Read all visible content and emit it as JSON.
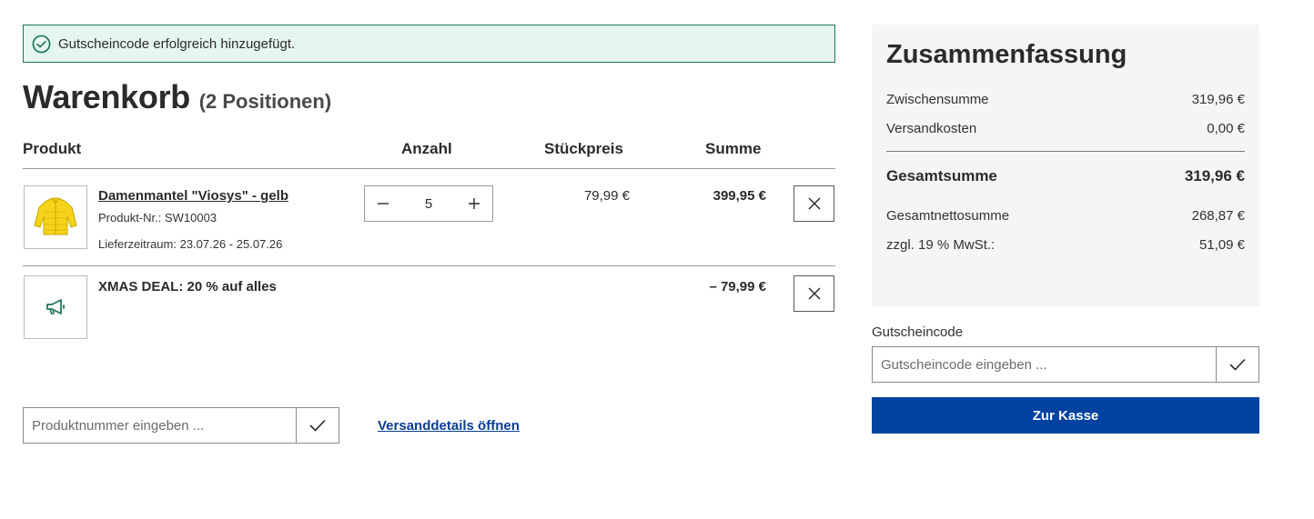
{
  "alert": {
    "message": "Gutscheincode erfolgreich hinzugefügt.",
    "icon": "check-circle-icon"
  },
  "cart": {
    "title": "Warenkorb",
    "count_label": "(2 Positionen)"
  },
  "columns": {
    "product": "Produkt",
    "quantity": "Anzahl",
    "unit_price": "Stückpreis",
    "total": "Summe"
  },
  "items": [
    {
      "name": "Damenmantel \"Viosys\" - gelb",
      "product_no": "Produkt-Nr.: SW10003",
      "delivery": "Lieferzeitraum: 23.07.26 - 25.07.26",
      "quantity": "5",
      "unit_price": "79,99 €",
      "total": "399,95 €",
      "image": "yellow-jacket-image"
    }
  ],
  "promotion": {
    "name": "XMAS DEAL: 20 % auf alles",
    "total": "– 79,99 €",
    "icon": "megaphone-icon"
  },
  "product_input": {
    "placeholder": "Produktnummer eingeben ..."
  },
  "shipping_link": "Versanddetails öffnen",
  "summary": {
    "title": "Zusammenfassung",
    "subtotal_label": "Zwischensumme",
    "subtotal": "319,96 €",
    "shipping_label": "Versandkosten",
    "shipping": "0,00 €",
    "grand_total_label": "Gesamtsumme",
    "grand_total": "319,96 €",
    "net_label": "Gesamtnettosumme",
    "net": "268,87 €",
    "vat_label": "zzgl. 19 % MwSt.:",
    "vat": "51,09 €"
  },
  "voucher": {
    "label": "Gutscheincode",
    "placeholder": "Gutscheincode eingeben ..."
  },
  "checkout_label": "Zur Kasse",
  "colors": {
    "accent": "#0042a0",
    "success_bg": "#e5f5ef",
    "success_border": "#1f7a55",
    "link": "#0b3d91"
  }
}
